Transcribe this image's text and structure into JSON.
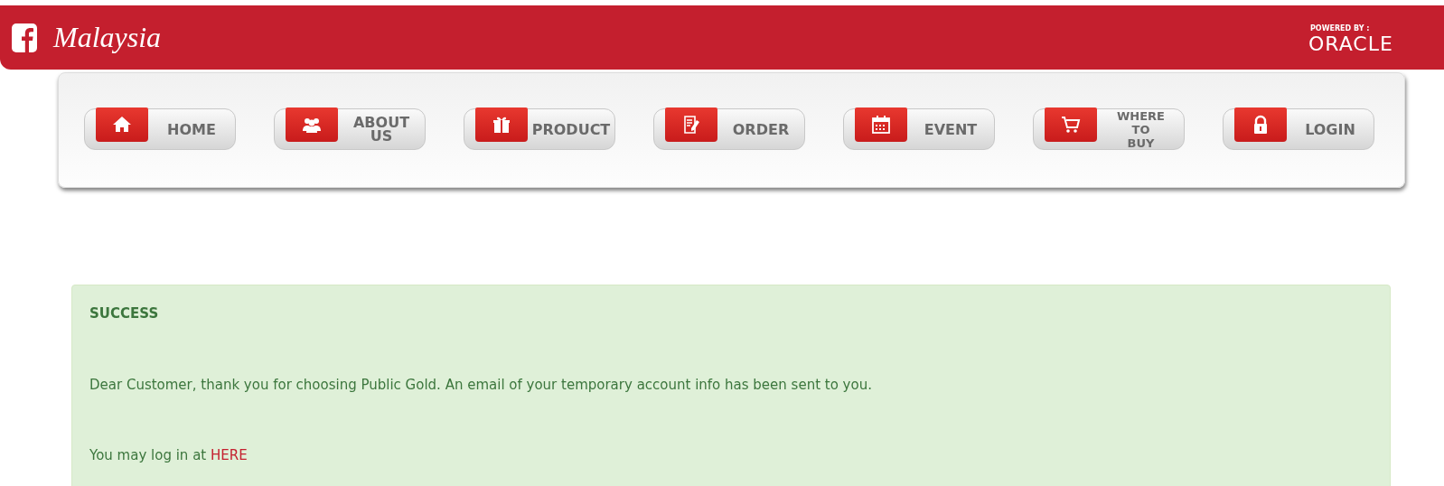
{
  "header": {
    "brand": "Malaysia",
    "powered_by": "POWERED BY :",
    "partner": "ORACLE"
  },
  "nav": [
    {
      "label": "HOME",
      "kind": "home"
    },
    {
      "label": "ABOUT US",
      "kind": "people"
    },
    {
      "label": "PRODUCT",
      "kind": "gift"
    },
    {
      "label": "ORDER",
      "kind": "order"
    },
    {
      "label": "EVENT",
      "kind": "calendar"
    },
    {
      "label": "WHERE TO BUY",
      "kind": "cart"
    },
    {
      "label": "LOGIN",
      "kind": "lock"
    }
  ],
  "alert": {
    "title": "SUCCESS",
    "message": "Dear Customer, thank you for choosing Public Gold. An email of your temporary account info has been sent to you.",
    "login_text": "You may log in at",
    "login_link": "HERE"
  }
}
